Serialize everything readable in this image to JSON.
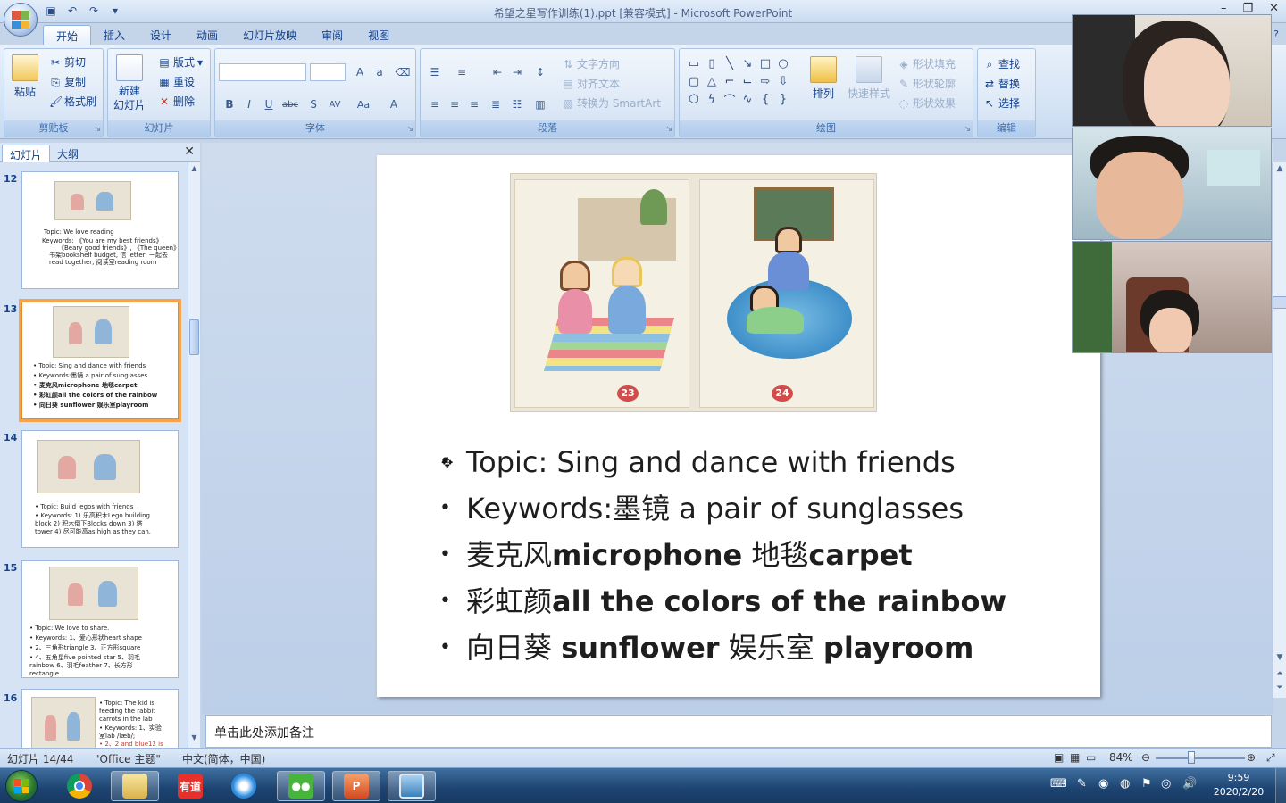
{
  "app": {
    "title": "希望之星写作训练(1).ppt [兼容模式] - Microsoft PowerPoint",
    "window_controls": [
      "minimize-icon",
      "restore-icon",
      "close-icon"
    ]
  },
  "ribbon": {
    "tabs": [
      {
        "label": "开始",
        "active": true
      },
      {
        "label": "插入"
      },
      {
        "label": "设计"
      },
      {
        "label": "动画"
      },
      {
        "label": "幻灯片放映"
      },
      {
        "label": "审阅"
      },
      {
        "label": "视图"
      }
    ],
    "clipboard": {
      "label": "剪贴板",
      "paste": "粘贴",
      "cut": "剪切",
      "copy": "复制",
      "format_painter": "格式刷"
    },
    "slides": {
      "label": "幻灯片",
      "new_slide": "新建\n幻灯片",
      "layout": "版式",
      "reset": "重设",
      "delete": "删除"
    },
    "font": {
      "label": "字体"
    },
    "paragraph": {
      "label": "段落",
      "text_direction": "文字方向",
      "align_text": "对齐文本",
      "smartart": "转换为 SmartArt"
    },
    "drawing": {
      "label": "绘图",
      "arrange": "排列",
      "quick_styles": "快速样式",
      "shape_fill": "形状填充",
      "shape_outline": "形状轮廓",
      "shape_effects": "形状效果"
    },
    "editing": {
      "label": "编辑",
      "find": "查找",
      "replace": "替换",
      "select": "选择"
    }
  },
  "left_panel": {
    "tabs": [
      {
        "label": "幻灯片",
        "active": true
      },
      {
        "label": "大纲"
      }
    ],
    "thumbnails": [
      {
        "num": "12",
        "lines": [
          "Topic:  We love reading",
          "Keywords: 《You are my best friends》,",
          "《Beary good friends》, 《The queen》",
          "书架bookshelf budget, 信 letter, 一起去",
          "read together, 阅读室reading room"
        ]
      },
      {
        "num": "13",
        "selected": true,
        "lines": [
          "• Topic:  Sing and dance with friends",
          "• Keywords:墨镜 a pair of sunglasses",
          "• 麦克风microphone 地毯carpet",
          "• 彩虹颜all the colors of the rainbow",
          "• 向日葵 sunflower 娱乐室playroom"
        ]
      },
      {
        "num": "14",
        "lines": [
          "• Topic:  Build legos with friends",
          "• Keywords: 1) 乐高积木Lego building",
          "  block 2) 积木倒下Blocks down 3) 塔",
          "  tower 4) 尽可能高as high as they can."
        ]
      },
      {
        "num": "15",
        "lines": [
          "• Topic:  We love to share.",
          "• Keywords: 1、爱心形状heart shape",
          "• 2、三角形triangle 3、正方形square",
          "• 4、五角星five pointed star 5、羽毛",
          "  rainbow 6、羽毛feather 7、长方形",
          "  rectangle"
        ]
      },
      {
        "num": "16",
        "lines": [
          "• Topic:  The kid is",
          "  feeding the rabbit",
          "  carrots in the lab",
          "• Keywords: 1、实验",
          "  室lab /læb/;",
          "• 2、2 and blue12 is"
        ]
      }
    ]
  },
  "slide": {
    "page_numbers": [
      "23",
      "24"
    ],
    "bullets": [
      {
        "plain": "Topic:  Sing and dance with friends",
        "bold": ""
      },
      {
        "plain": "Keywords:墨镜 a pair of sunglasses",
        "bold": ""
      },
      {
        "plain": "麦克风",
        "bold": "microphone",
        "plain2": " 地毯",
        "bold2": "carpet"
      },
      {
        "plain": "彩虹颜",
        "bold": "all the colors of the rainbow"
      },
      {
        "plain": "向日葵 ",
        "bold": "sunflower",
        "plain2": " 娱乐室 ",
        "bold2": "playroom"
      }
    ]
  },
  "notes": {
    "placeholder": "单击此处添加备注"
  },
  "status": {
    "slide": "幻灯片 14/44",
    "theme": "\"Office 主题\"",
    "language": "中文(简体，中国)",
    "zoom": "84%"
  },
  "taskbar": {
    "apps": [
      "windows-explorer",
      "chrome",
      "youdao",
      "browser",
      "wechat",
      "powerpoint",
      "photo-viewer"
    ],
    "youdao_label": "有道",
    "time": "9:59",
    "date": "2020/2/20"
  },
  "colors": {
    "ribbon": "#d3e2f4",
    "accent": "#15428b",
    "selection": "#f6a44b"
  }
}
